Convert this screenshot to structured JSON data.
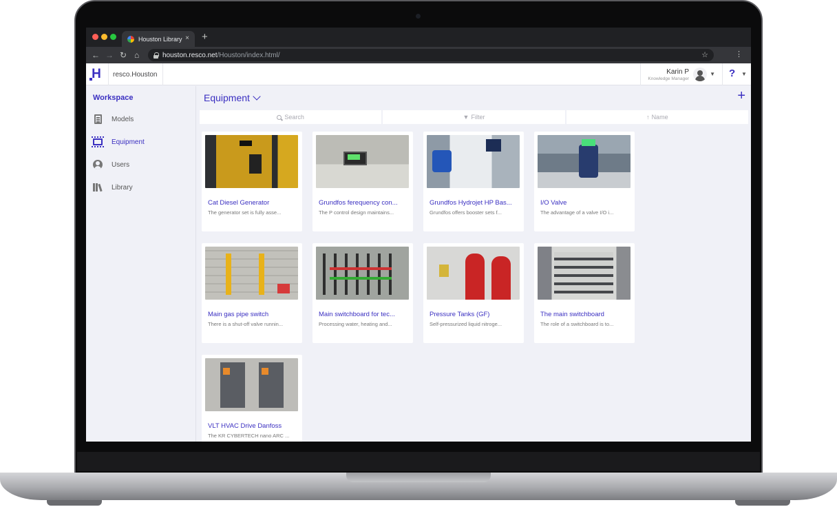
{
  "browser": {
    "tab_title": "Houston Library",
    "tab_close": "×",
    "new_tab": "+",
    "url_host": "houston.resco.net",
    "url_path": "/Houston/index.html/"
  },
  "header": {
    "org_name": "resco.Houston",
    "user_name": "Karin P",
    "user_role": "Knowledge Manager",
    "help": "?"
  },
  "sidebar": {
    "title": "Workspace",
    "items": [
      {
        "label": "Models",
        "icon": "models-icon"
      },
      {
        "label": "Equipment",
        "icon": "equipment-icon",
        "active": true
      },
      {
        "label": "Users",
        "icon": "users-icon"
      },
      {
        "label": "Library",
        "icon": "library-icon"
      }
    ]
  },
  "main": {
    "title": "Equipment",
    "toolbar": {
      "search": "Search",
      "filter": "Filter",
      "sort": "Name"
    },
    "cards": [
      {
        "title": "Cat Diesel Generator",
        "desc": "The generator set is fully asse..."
      },
      {
        "title": "Grundfos ferequency con...",
        "desc": "The P control design maintains..."
      },
      {
        "title": "Grundfos Hydrojet HP Bas...",
        "desc": "Grundfos offers booster sets f..."
      },
      {
        "title": "I/O Valve",
        "desc": "The advantage of a valve I/O i..."
      },
      {
        "title": "Main gas pipe switch",
        "desc": "There is a shut-off valve runnin..."
      },
      {
        "title": "Main switchboard for tec...",
        "desc": "Processing water, heating and..."
      },
      {
        "title": "Pressure Tanks (GF)",
        "desc": "Self-pressurized liquid nitroge..."
      },
      {
        "title": "The main switchboard",
        "desc": "The role of a switchboard is to..."
      },
      {
        "title": "VLT HVAC Drive Danfoss",
        "desc": "The KR CYBERTECH nano ARC ..."
      }
    ]
  },
  "colors": {
    "accent": "#3a2fc1",
    "sidebar_bg": "#f0f1f7"
  }
}
